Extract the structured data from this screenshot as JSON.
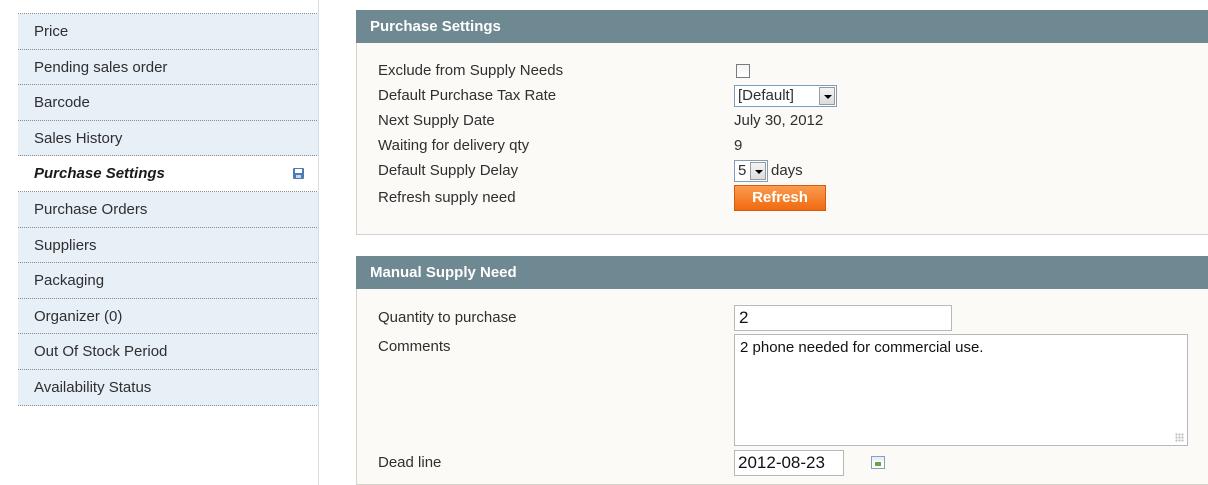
{
  "sidebar": {
    "items": [
      {
        "label": "Price",
        "active": false
      },
      {
        "label": "Pending sales order",
        "active": false
      },
      {
        "label": "Barcode",
        "active": false
      },
      {
        "label": "Sales History",
        "active": false
      },
      {
        "label": "Purchase Settings",
        "active": true
      },
      {
        "label": "Purchase Orders",
        "active": false
      },
      {
        "label": "Suppliers",
        "active": false
      },
      {
        "label": "Packaging",
        "active": false
      },
      {
        "label": "Organizer (0)",
        "active": false
      },
      {
        "label": "Out Of Stock Period",
        "active": false
      },
      {
        "label": "Availability Status",
        "active": false
      }
    ],
    "active_icon": "save-icon"
  },
  "purchase_settings": {
    "title": "Purchase Settings",
    "exclude_label": "Exclude from Supply Needs",
    "exclude_checked": false,
    "tax_rate_label": "Default Purchase Tax Rate",
    "tax_rate_value": "[Default]",
    "next_supply_label": "Next Supply Date",
    "next_supply_value": "July 30, 2012",
    "waiting_label": "Waiting for delivery qty",
    "waiting_value": "9",
    "delay_label": "Default Supply Delay",
    "delay_value": "5",
    "delay_unit": "days",
    "refresh_label": "Refresh supply need",
    "refresh_button": "Refresh"
  },
  "manual_supply": {
    "title": "Manual Supply Need",
    "qty_label": "Quantity to purchase",
    "qty_value": "2",
    "comments_label": "Comments",
    "comments_value": "2 phone needed for commercial use.",
    "deadline_label": "Dead line",
    "deadline_value": "2012-08-23"
  },
  "colors": {
    "section_header": "#6f8992",
    "tab_bg": "#e7eff7",
    "button_orange": "#f06a10"
  }
}
